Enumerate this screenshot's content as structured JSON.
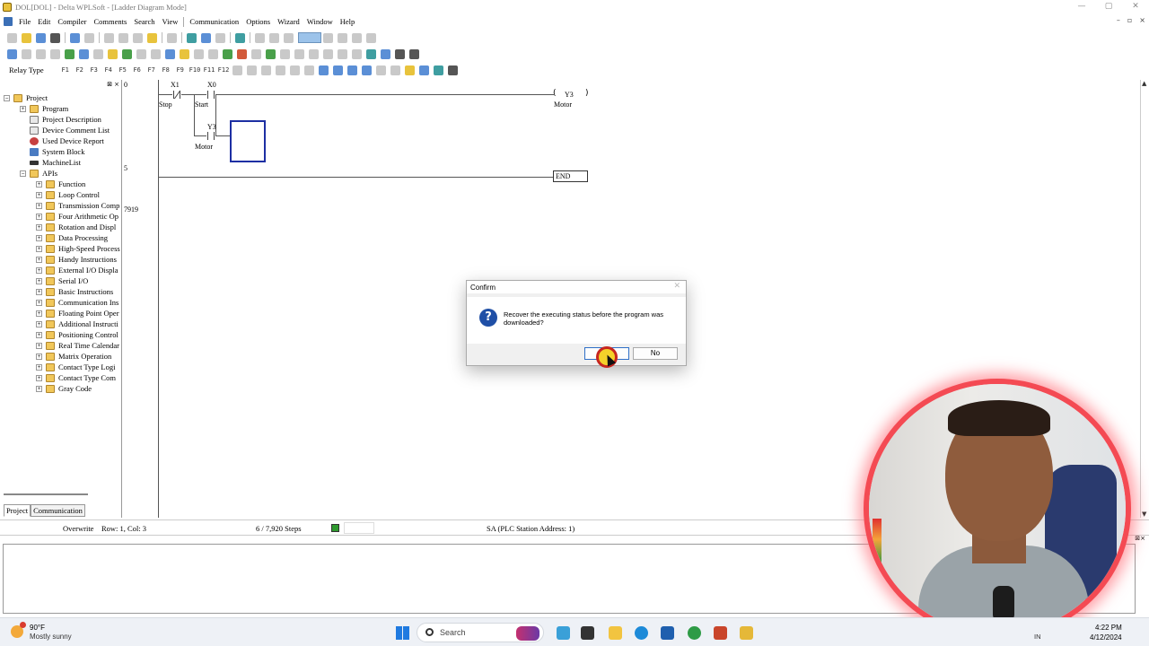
{
  "window": {
    "title": "DOL[DOL] - Delta WPLSoft - [Ladder Diagram Mode]",
    "controls": [
      "—",
      "▢",
      "✕"
    ],
    "mdi_controls": [
      "–",
      "▫",
      "×"
    ]
  },
  "menu": {
    "items": [
      "File",
      "Edit",
      "Compiler",
      "Comments",
      "Search",
      "View",
      "Communication",
      "Options",
      "Wizard",
      "Window",
      "Help"
    ]
  },
  "toolbar3": {
    "relay_type_label": "Relay Type",
    "symbols": [
      "F1",
      "F2",
      "F3",
      "F4",
      "F5",
      "F6",
      "F7",
      "F8",
      "F9",
      "F10",
      "F11",
      "F12"
    ]
  },
  "tree": {
    "header_controls": [
      "⊠",
      "×"
    ],
    "root": "Project",
    "items": [
      {
        "label": "Program",
        "level": 1,
        "expand": "+",
        "icon": "folder"
      },
      {
        "label": "Project Description",
        "level": 1,
        "expand": "",
        "icon": "doc"
      },
      {
        "label": "Device Comment List",
        "level": 1,
        "expand": "",
        "icon": "doc"
      },
      {
        "label": "Used Device Report",
        "level": 1,
        "expand": "",
        "icon": "red"
      },
      {
        "label": "System Block",
        "level": 1,
        "expand": "",
        "icon": "blue"
      },
      {
        "label": "MachineList",
        "level": 1,
        "expand": "",
        "icon": "black"
      },
      {
        "label": "APIs",
        "level": 1,
        "expand": "−",
        "icon": "folder"
      },
      {
        "label": "Function",
        "level": 2,
        "expand": "+",
        "icon": "folder"
      },
      {
        "label": "Loop Control",
        "level": 2,
        "expand": "+",
        "icon": "folder"
      },
      {
        "label": "Transmission Comp",
        "level": 2,
        "expand": "+",
        "icon": "folder"
      },
      {
        "label": "Four Arithmetic Op",
        "level": 2,
        "expand": "+",
        "icon": "folder"
      },
      {
        "label": "Rotation and Displ",
        "level": 2,
        "expand": "+",
        "icon": "folder"
      },
      {
        "label": "Data Processing",
        "level": 2,
        "expand": "+",
        "icon": "folder"
      },
      {
        "label": "High-Speed Process",
        "level": 2,
        "expand": "+",
        "icon": "folder"
      },
      {
        "label": "Handy Instructions",
        "level": 2,
        "expand": "+",
        "icon": "folder"
      },
      {
        "label": "External I/O Displa",
        "level": 2,
        "expand": "+",
        "icon": "folder"
      },
      {
        "label": "Serial I/O",
        "level": 2,
        "expand": "+",
        "icon": "folder"
      },
      {
        "label": "Basic Instructions",
        "level": 2,
        "expand": "+",
        "icon": "folder"
      },
      {
        "label": "Communication Ins",
        "level": 2,
        "expand": "+",
        "icon": "folder"
      },
      {
        "label": "Floating Point Oper",
        "level": 2,
        "expand": "+",
        "icon": "folder"
      },
      {
        "label": "Additional Instructi",
        "level": 2,
        "expand": "+",
        "icon": "folder"
      },
      {
        "label": "Positioning Control",
        "level": 2,
        "expand": "+",
        "icon": "folder"
      },
      {
        "label": "Real Time Calendar",
        "level": 2,
        "expand": "+",
        "icon": "folder"
      },
      {
        "label": "Matrix Operation",
        "level": 2,
        "expand": "+",
        "icon": "folder"
      },
      {
        "label": "Contact Type Logi",
        "level": 2,
        "expand": "+",
        "icon": "folder"
      },
      {
        "label": "Contact Type Com",
        "level": 2,
        "expand": "+",
        "icon": "folder"
      },
      {
        "label": "Gray Code",
        "level": 2,
        "expand": "+",
        "icon": "folder"
      }
    ],
    "tabs": [
      "Project",
      "Communication"
    ]
  },
  "ladder": {
    "rung_numbers": [
      "0",
      "5",
      "7919"
    ],
    "contact1_name": "X1",
    "contact1_comment": "Stop",
    "contact2_name": "X0",
    "contact2_comment": "Start",
    "contact3_name": "Y3",
    "contact3_comment": "Motor",
    "coil_name": "Y3",
    "coil_comment": "Motor",
    "coil_open": "(",
    "coil_close": ")",
    "end_label": "END"
  },
  "statusbar": {
    "mode": "Overwrite",
    "position": "Row: 1, Col: 3",
    "steps": "6 / 7,920 Steps",
    "station": "SA (PLC Station Address: 1)"
  },
  "output": {
    "controls": "⊠×"
  },
  "dialog": {
    "title": "Confirm",
    "close": "✕",
    "icon_glyph": "?",
    "message": "Recover the executing status before the program was downloaded?",
    "yes_label": "",
    "no_label": "No"
  },
  "taskbar": {
    "temperature": "90°F",
    "weather": "Mostly sunny",
    "search_label": "Search",
    "lang": "IN",
    "time": "4:22 PM",
    "date": "4/12/2024"
  }
}
